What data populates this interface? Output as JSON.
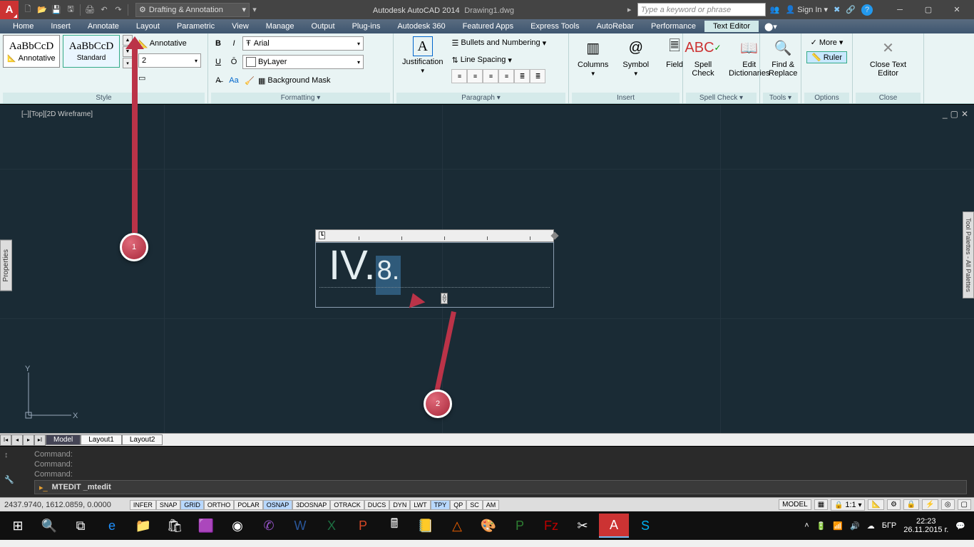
{
  "title": {
    "app": "Autodesk AutoCAD 2014",
    "doc": "Drawing1.dwg"
  },
  "search_placeholder": "Type a keyword or phrase",
  "signin": "Sign In",
  "workspace": "Drafting & Annotation",
  "menus": [
    "Home",
    "Insert",
    "Annotate",
    "Layout",
    "Parametric",
    "View",
    "Manage",
    "Output",
    "Plug-ins",
    "Autodesk 360",
    "Featured Apps",
    "Express Tools",
    "AutoRebar",
    "Performance",
    "Text Editor"
  ],
  "active_menu": 14,
  "ribbon": {
    "style": {
      "title": "Style",
      "annotative": "Annotative",
      "standard": "Standard",
      "sample": "AaBbCcD",
      "ann_chk": "Annotative",
      "height": "2"
    },
    "formatting": {
      "title": "Formatting  ▾",
      "font": "Arial",
      "layer": "ByLayer",
      "bgmask": "Background Mask"
    },
    "paragraph": {
      "title": "Paragraph  ▾",
      "just": "Justification",
      "bullets": "Bullets and Numbering",
      "spacing": "Line Spacing"
    },
    "insert": {
      "title": "Insert",
      "columns": "Columns",
      "symbol": "Symbol",
      "field": "Field"
    },
    "spell": {
      "title": "Spell Check  ▾",
      "spell": "Spell\nCheck",
      "dict": "Edit\nDictionaries"
    },
    "tools": {
      "title": "Tools  ▾",
      "find": "Find &\nReplace"
    },
    "options": {
      "title": "Options",
      "more": "More",
      "ruler": "Ruler"
    },
    "close": {
      "title": "Close",
      "btn": "Close Text Editor"
    }
  },
  "viewport_label": "[–][Top][2D Wireframe]",
  "mtext": {
    "part1": "IV.",
    "part2": "8."
  },
  "callouts": {
    "c1": "1",
    "c2": "2"
  },
  "properties_tab": "Properties",
  "tools_tab": "Tool Palettes - All Palettes",
  "layout_tabs": [
    "Model",
    "Layout1",
    "Layout2"
  ],
  "cmd_history": [
    "Command:",
    "Command:",
    "Command:"
  ],
  "cmd_current": "MTEDIT _mtedit",
  "status": {
    "coords": "2437.9740, 1612.0859, 0.0000",
    "toggles": [
      "INFER",
      "SNAP",
      "GRID",
      "ORTHO",
      "POLAR",
      "OSNAP",
      "3DOSNAP",
      "OTRACK",
      "DUCS",
      "DYN",
      "LWT",
      "TPY",
      "QP",
      "SC",
      "AM"
    ],
    "toggles_on": [
      2,
      5,
      11
    ],
    "model": "MODEL",
    "scale": "1:1"
  },
  "tray": {
    "lang": "БГР",
    "time": "22:23",
    "date": "26.11.2015 г."
  }
}
